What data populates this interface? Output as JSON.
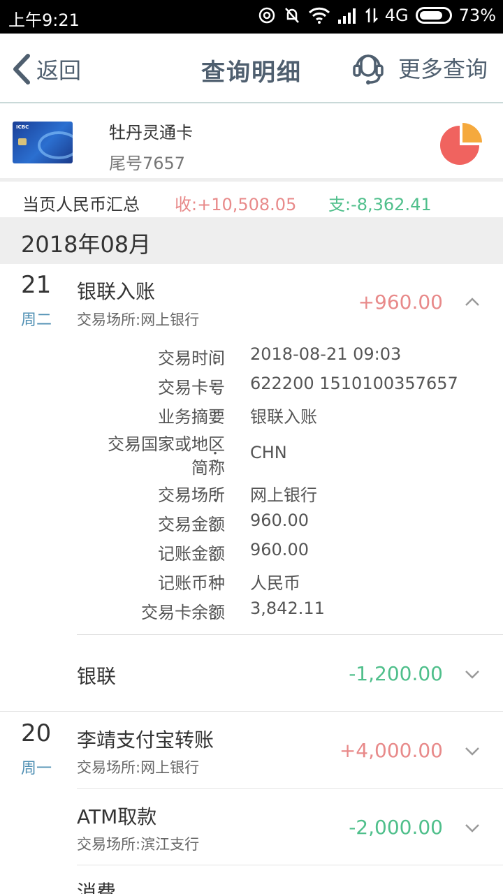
{
  "status_bar": {
    "time": "上午9:21",
    "network": "4G",
    "battery": "73%"
  },
  "header": {
    "back_label": "返回",
    "title": "查询明细",
    "more_label": "更多查询"
  },
  "card": {
    "name": "牡丹灵通卡",
    "tail": "尾号7657"
  },
  "summary": {
    "label": "当页人民币汇总",
    "income": "收:+10,508.05",
    "expense": "支:-8,362.41"
  },
  "month": "2018年08月",
  "days": [
    {
      "day": "21",
      "weekday": "周二",
      "transactions": [
        {
          "name": "银联入账",
          "place": "交易场所:网上银行",
          "amount": "+960.00",
          "expanded": true,
          "details": [
            {
              "key": "交易时间",
              "value": "2018-08-21 09:03"
            },
            {
              "key": "交易卡号",
              "value": "622200 1510100357657"
            },
            {
              "key": "业务摘要",
              "value": "银联入账"
            },
            {
              "key": "交易国家或地区简称",
              "key_line1": "交易国家或地区",
              "key_line2": "简称",
              "value": "CHN"
            },
            {
              "key": "交易场所",
              "value": "网上银行"
            },
            {
              "key": "交易金额",
              "value": "960.00"
            },
            {
              "key": "记账金额",
              "value": "960.00"
            },
            {
              "key": "记账币种",
              "value": "人民币"
            },
            {
              "key": "交易卡余额",
              "value": "3,842.11"
            }
          ]
        },
        {
          "name": "银联",
          "amount": "-1,200.00",
          "expanded": false
        }
      ]
    },
    {
      "day": "20",
      "weekday": "周一",
      "transactions": [
        {
          "name": "李靖支付宝转账",
          "place": "交易场所:网上银行",
          "amount": "+4,000.00",
          "expanded": false
        },
        {
          "name": "ATM取款",
          "place": "交易场所:滨江支行",
          "amount": "-2,000.00",
          "expanded": false
        },
        {
          "name": "消费",
          "expanded": false
        }
      ]
    }
  ],
  "detail_colon": "：",
  "colors": {
    "income": "#e88a8a",
    "expense": "#4fbf8b",
    "header_text": "#4f5f6f",
    "weekday": "#4f8fb3",
    "pie_main": "#f0635f",
    "pie_slice": "#f5a93d"
  }
}
